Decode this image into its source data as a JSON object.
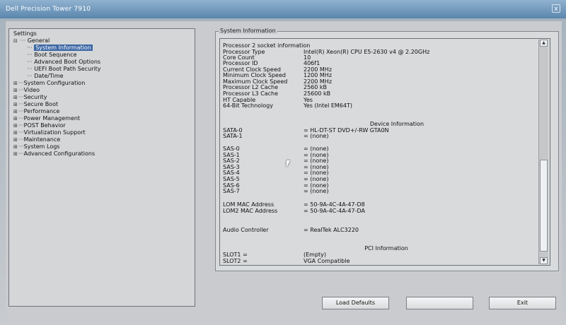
{
  "window": {
    "title": "Dell Precision Tower 7910",
    "close": "x"
  },
  "tree": {
    "root": "Settings",
    "items": [
      {
        "label": "General",
        "expanded": true
      },
      {
        "label": "System Information",
        "selected": true,
        "child": true
      },
      {
        "label": "Boot Sequence",
        "child": true
      },
      {
        "label": "Advanced Boot Options",
        "child": true
      },
      {
        "label": "UEFI Boot Path Security",
        "child": true
      },
      {
        "label": "Date/Time",
        "child": true
      },
      {
        "label": "System Configuration"
      },
      {
        "label": "Video"
      },
      {
        "label": "Security"
      },
      {
        "label": "Secure Boot"
      },
      {
        "label": "Performance"
      },
      {
        "label": "Power Management"
      },
      {
        "label": "POST Behavior"
      },
      {
        "label": "Virtualization Support"
      },
      {
        "label": "Maintenance"
      },
      {
        "label": "System Logs"
      },
      {
        "label": "Advanced Configurations"
      }
    ]
  },
  "info": {
    "group_title": "System Information",
    "processor_header": "Processor 2 socket information",
    "processor": [
      [
        "Processor Type",
        "Intel(R) Xeon(R) CPU E5-2630 v4 @ 2.20GHz"
      ],
      [
        "Core Count",
        "10"
      ],
      [
        "Processor ID",
        "406f1"
      ],
      [
        "Current Clock Speed",
        "2200 MHz"
      ],
      [
        "Minimum Clock Speed",
        "1200 MHz"
      ],
      [
        "Maximum Clock Speed",
        "2200 MHz"
      ],
      [
        "Processor L2 Cache",
        "2560 kB"
      ],
      [
        "Processor L3 Cache",
        "25600 kB"
      ],
      [
        "HT Capable",
        "Yes"
      ],
      [
        "64-Bit Technology",
        "Yes (Intel EM64T)"
      ]
    ],
    "device_header": "Device Information",
    "sata": [
      [
        "SATA-0",
        "= HL-DT-ST DVD+/-RW GTA0N"
      ],
      [
        "SATA-1",
        "= (none)"
      ]
    ],
    "sas": [
      [
        "SAS-0",
        "= (none)"
      ],
      [
        "SAS-1",
        "= (none)"
      ],
      [
        "SAS-2",
        "= (none)"
      ],
      [
        "SAS-3",
        "= (none)"
      ],
      [
        "SAS-4",
        "= (none)"
      ],
      [
        "SAS-5",
        "= (none)"
      ],
      [
        "SAS-6",
        "= (none)"
      ],
      [
        "SAS-7",
        "= (none)"
      ]
    ],
    "mac": [
      [
        "LOM MAC Address",
        "= 50-9A-4C-4A-47-D8"
      ],
      [
        "LOM2 MAC Address",
        "= 50-9A-4C-4A-47-DA"
      ]
    ],
    "audio": [
      "Audio Controller",
      "= RealTek ALC3220"
    ],
    "pci_header": "PCI Information",
    "slots": [
      [
        "SLOT1 =",
        "(Empty)"
      ],
      [
        "SLOT2 =",
        "VGA Compatible"
      ]
    ]
  },
  "buttons": {
    "load_defaults": "Load Defaults",
    "blank": "",
    "exit": "Exit"
  }
}
